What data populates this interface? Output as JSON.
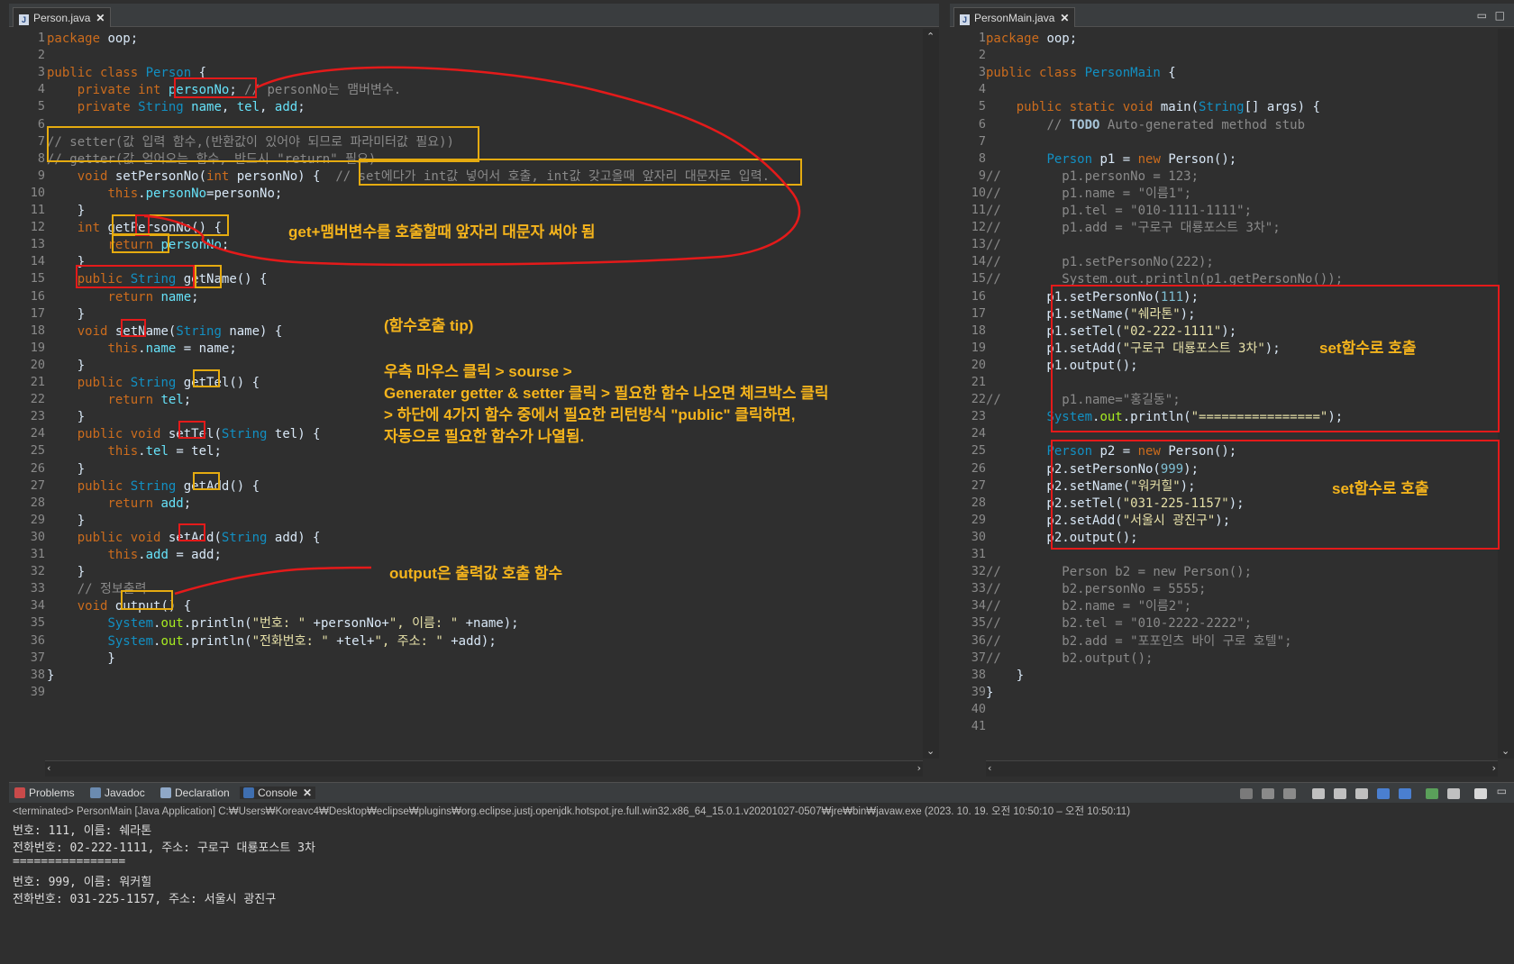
{
  "left_editor": {
    "tab": "Person.java",
    "lines": [
      [
        [
          "kw",
          "package "
        ],
        [
          "",
          "oop;"
        ]
      ],
      [],
      [
        [
          "kw",
          "public class "
        ],
        [
          "ty",
          "Person "
        ],
        [
          "",
          "{"
        ]
      ],
      [
        [
          "",
          "    "
        ],
        [
          "kw",
          "private int "
        ],
        [
          "fld",
          "personNo"
        ],
        [
          "",
          ";"
        ],
        [
          "cm",
          " // personNo는 맴버변수."
        ]
      ],
      [
        [
          "",
          "    "
        ],
        [
          "kw",
          "private "
        ],
        [
          "ty",
          "String "
        ],
        [
          "fld",
          "name"
        ],
        [
          "",
          ", "
        ],
        [
          "fld",
          "tel"
        ],
        [
          "",
          ", "
        ],
        [
          "fld",
          "add"
        ],
        [
          "",
          ";"
        ]
      ],
      [],
      [
        [
          "cm",
          "// setter(값 입력 함수,(반환값이 있어야 되므로 파라미터값 필요))"
        ]
      ],
      [
        [
          "cm",
          "// getter(값 얻어오는 함수, 반드시 \"return\" 필요)"
        ]
      ],
      [
        [
          "",
          "    "
        ],
        [
          "kw",
          "void "
        ],
        [
          "",
          "setPersonNo("
        ],
        [
          "kw",
          "int "
        ],
        [
          "",
          "personNo) {  "
        ],
        [
          "cm",
          "// set에다가 int값 넣어서 호출, int값 갖고올때 앞자리 대문자로 입력."
        ]
      ],
      [
        [
          "",
          "        "
        ],
        [
          "kw",
          "this"
        ],
        [
          "",
          "."
        ],
        [
          "fld",
          "personNo"
        ],
        [
          "",
          "=personNo;"
        ]
      ],
      [
        [
          "",
          "    }"
        ]
      ],
      [
        [
          "",
          "    "
        ],
        [
          "kw",
          "int "
        ],
        [
          "",
          "getPersonNo() {"
        ]
      ],
      [
        [
          "",
          "        "
        ],
        [
          "kw",
          "return "
        ],
        [
          "fld",
          "personNo"
        ],
        [
          "",
          ";"
        ]
      ],
      [
        [
          "",
          "    }"
        ]
      ],
      [
        [
          "",
          "    "
        ],
        [
          "kw",
          "public "
        ],
        [
          "ty",
          "String "
        ],
        [
          "",
          "getName() {"
        ]
      ],
      [
        [
          "",
          "        "
        ],
        [
          "kw",
          "return "
        ],
        [
          "fld",
          "name"
        ],
        [
          "",
          ";"
        ]
      ],
      [
        [
          "",
          "    }"
        ]
      ],
      [
        [
          "",
          "    "
        ],
        [
          "kw",
          "void "
        ],
        [
          "",
          "setName("
        ],
        [
          "ty",
          "String "
        ],
        [
          "",
          "name) {"
        ]
      ],
      [
        [
          "",
          "        "
        ],
        [
          "kw",
          "this"
        ],
        [
          "",
          "."
        ],
        [
          "fld",
          "name"
        ],
        [
          "",
          " = name;"
        ]
      ],
      [
        [
          "",
          "    }"
        ]
      ],
      [
        [
          "",
          "    "
        ],
        [
          "kw",
          "public "
        ],
        [
          "ty",
          "String "
        ],
        [
          "",
          "getTel() {"
        ]
      ],
      [
        [
          "",
          "        "
        ],
        [
          "kw",
          "return "
        ],
        [
          "fld",
          "tel"
        ],
        [
          "",
          ";"
        ]
      ],
      [
        [
          "",
          "    }"
        ]
      ],
      [
        [
          "",
          "    "
        ],
        [
          "kw",
          "public void "
        ],
        [
          "",
          "setTel("
        ],
        [
          "ty",
          "String "
        ],
        [
          "",
          "tel) {"
        ]
      ],
      [
        [
          "",
          "        "
        ],
        [
          "kw",
          "this"
        ],
        [
          "",
          "."
        ],
        [
          "fld",
          "tel"
        ],
        [
          "",
          " = tel;"
        ]
      ],
      [
        [
          "",
          "    }"
        ]
      ],
      [
        [
          "",
          "    "
        ],
        [
          "kw",
          "public "
        ],
        [
          "ty",
          "String "
        ],
        [
          "",
          "getAdd() {"
        ]
      ],
      [
        [
          "",
          "        "
        ],
        [
          "kw",
          "return "
        ],
        [
          "fld",
          "add"
        ],
        [
          "",
          ";"
        ]
      ],
      [
        [
          "",
          "    }"
        ]
      ],
      [
        [
          "",
          "    "
        ],
        [
          "kw",
          "public void "
        ],
        [
          "",
          "setAdd("
        ],
        [
          "ty",
          "String "
        ],
        [
          "",
          "add) {"
        ]
      ],
      [
        [
          "",
          "        "
        ],
        [
          "kw",
          "this"
        ],
        [
          "",
          "."
        ],
        [
          "fld",
          "add"
        ],
        [
          "",
          " = add;"
        ]
      ],
      [
        [
          "",
          "    }"
        ]
      ],
      [
        [
          "",
          "    "
        ],
        [
          "cm",
          "// 정보출력"
        ]
      ],
      [
        [
          "",
          "    "
        ],
        [
          "kw",
          "void "
        ],
        [
          "",
          "output() {"
        ]
      ],
      [
        [
          "",
          "        "
        ],
        [
          "ty",
          "System"
        ],
        [
          "",
          "."
        ],
        [
          "meth",
          "out"
        ],
        [
          "",
          ".println("
        ],
        [
          "str",
          "\"번호: \""
        ],
        [
          "",
          " +personNo+"
        ],
        [
          "str",
          "\", 이름: \""
        ],
        [
          "",
          " +name);"
        ]
      ],
      [
        [
          "",
          "        "
        ],
        [
          "ty",
          "System"
        ],
        [
          "",
          "."
        ],
        [
          "meth",
          "out"
        ],
        [
          "",
          ".println("
        ],
        [
          "str",
          "\"전화번호: \""
        ],
        [
          "",
          " +tel+"
        ],
        [
          "str",
          "\", 주소: \""
        ],
        [
          "",
          " +add);"
        ]
      ],
      [
        [
          "",
          "        }"
        ]
      ],
      [
        [
          "",
          "}"
        ]
      ],
      []
    ],
    "annotations": {
      "get_note": "get+맴버변수를 호출할때 앞자리 대문자 써야 됨",
      "tip_title": "(함수호출 tip)",
      "tip_1": "우측 마우스 클릭 > sourse >",
      "tip_2": "Generater getter & setter 클릭 > 필요한 함수 나오면 체크박스 클릭",
      "tip_3": "> 하단에 4가지 함수 중에서 필요한 리턴방식 \"public\" 클릭하면,",
      "tip_4": "자동으로 필요한 함수가 나열됨.",
      "output_note": "output은 출력값 호출 함수"
    }
  },
  "right_editor": {
    "tab": "PersonMain.java",
    "lines": [
      [
        [
          "kw",
          "package "
        ],
        [
          "",
          "oop;"
        ]
      ],
      [],
      [
        [
          "kw",
          "public class "
        ],
        [
          "ty",
          "PersonMain "
        ],
        [
          "",
          "{"
        ]
      ],
      [],
      [
        [
          "",
          "    "
        ],
        [
          "kw",
          "public static void "
        ],
        [
          "",
          "main("
        ],
        [
          "ty",
          "String"
        ],
        [
          "",
          "[] args) {"
        ]
      ],
      [
        [
          "",
          "        "
        ],
        [
          "cm",
          "// "
        ],
        [
          "todo",
          "TODO "
        ],
        [
          "cm",
          "Auto-generated method stub"
        ]
      ],
      [],
      [
        [
          "",
          "        "
        ],
        [
          "ty",
          "Person "
        ],
        [
          "",
          "p1 = "
        ],
        [
          "kw",
          "new "
        ],
        [
          "",
          "Person();"
        ]
      ],
      [
        [
          "cm",
          "//        p1.personNo = 123;"
        ]
      ],
      [
        [
          "cm",
          "//        p1.name = \"이름1\";"
        ]
      ],
      [
        [
          "cm",
          "//        p1.tel = \"010-1111-1111\";"
        ]
      ],
      [
        [
          "cm",
          "//        p1.add = \"구로구 대룡포스트 3차\";"
        ]
      ],
      [
        [
          "cm",
          "//"
        ]
      ],
      [
        [
          "cm",
          "//        p1.setPersonNo(222);"
        ]
      ],
      [
        [
          "cm",
          "//        System.out.println(p1.getPersonNo());"
        ]
      ],
      [
        [
          "",
          "        p1.setPersonNo("
        ],
        [
          "num",
          "111"
        ],
        [
          "",
          ");"
        ]
      ],
      [
        [
          "",
          "        p1.setName("
        ],
        [
          "str",
          "\"쉐라톤\""
        ],
        [
          "",
          ");"
        ]
      ],
      [
        [
          "",
          "        p1.setTel("
        ],
        [
          "str",
          "\"02-222-1111\""
        ],
        [
          "",
          ");"
        ]
      ],
      [
        [
          "",
          "        p1.setAdd("
        ],
        [
          "str",
          "\"구로구 대룡포스트 3차\""
        ],
        [
          "",
          ");"
        ]
      ],
      [
        [
          "",
          "        p1.output();"
        ]
      ],
      [],
      [
        [
          "cm",
          "//        p1.name=\"홍길동\";"
        ]
      ],
      [
        [
          "",
          "        "
        ],
        [
          "ty",
          "System"
        ],
        [
          "",
          "."
        ],
        [
          "meth",
          "out"
        ],
        [
          "",
          ".println("
        ],
        [
          "str",
          "\"================\""
        ],
        [
          "",
          ");"
        ]
      ],
      [],
      [
        [
          "",
          "        "
        ],
        [
          "ty",
          "Person "
        ],
        [
          "",
          "p2 = "
        ],
        [
          "kw",
          "new "
        ],
        [
          "",
          "Person();"
        ]
      ],
      [
        [
          "",
          "        p2.setPersonNo("
        ],
        [
          "num",
          "999"
        ],
        [
          "",
          ");"
        ]
      ],
      [
        [
          "",
          "        p2.setName("
        ],
        [
          "str",
          "\"워커힐\""
        ],
        [
          "",
          ");"
        ]
      ],
      [
        [
          "",
          "        p2.setTel("
        ],
        [
          "str",
          "\"031-225-1157\""
        ],
        [
          "",
          ");"
        ]
      ],
      [
        [
          "",
          "        p2.setAdd("
        ],
        [
          "str",
          "\"서울시 광진구\""
        ],
        [
          "",
          ");"
        ]
      ],
      [
        [
          "",
          "        p2.output();"
        ]
      ],
      [],
      [
        [
          "cm",
          "//        Person b2 = new Person();"
        ]
      ],
      [
        [
          "cm",
          "//        b2.personNo = 5555;"
        ]
      ],
      [
        [
          "cm",
          "//        b2.name = \"이름2\";"
        ]
      ],
      [
        [
          "cm",
          "//        b2.tel = \"010-2222-2222\";"
        ]
      ],
      [
        [
          "cm",
          "//        b2.add = \"포포인츠 바이 구로 호텔\";"
        ]
      ],
      [
        [
          "cm",
          "//        b2.output();"
        ]
      ],
      [
        [
          "",
          "    }"
        ]
      ],
      [
        [
          "",
          "}"
        ]
      ],
      [],
      []
    ],
    "annotations": {
      "set_note_1": "set함수로 호출",
      "set_note_2": "set함수로 호출"
    }
  },
  "console": {
    "tabs": [
      "Problems",
      "Javadoc",
      "Declaration",
      "Console"
    ],
    "info": "<terminated> PersonMain [Java Application] C:₩Users₩Koreavc4₩Desktop₩eclipse₩plugins₩org.eclipse.justj.openjdk.hotspot.jre.full.win32.x86_64_15.0.1.v20201027-0507₩jre₩bin₩javaw.exe  (2023. 10. 19. 오전 10:50:10 – 오전 10:50:11)",
    "output": [
      "번호: 111, 이름: 쉐라톤",
      "전화번호: 02-222-1111, 주소: 구로구 대룡포스트 3차",
      "================",
      "번호: 999, 이름: 워커힐",
      "전화번호: 031-225-1157, 주소: 서울시 광진구"
    ]
  }
}
